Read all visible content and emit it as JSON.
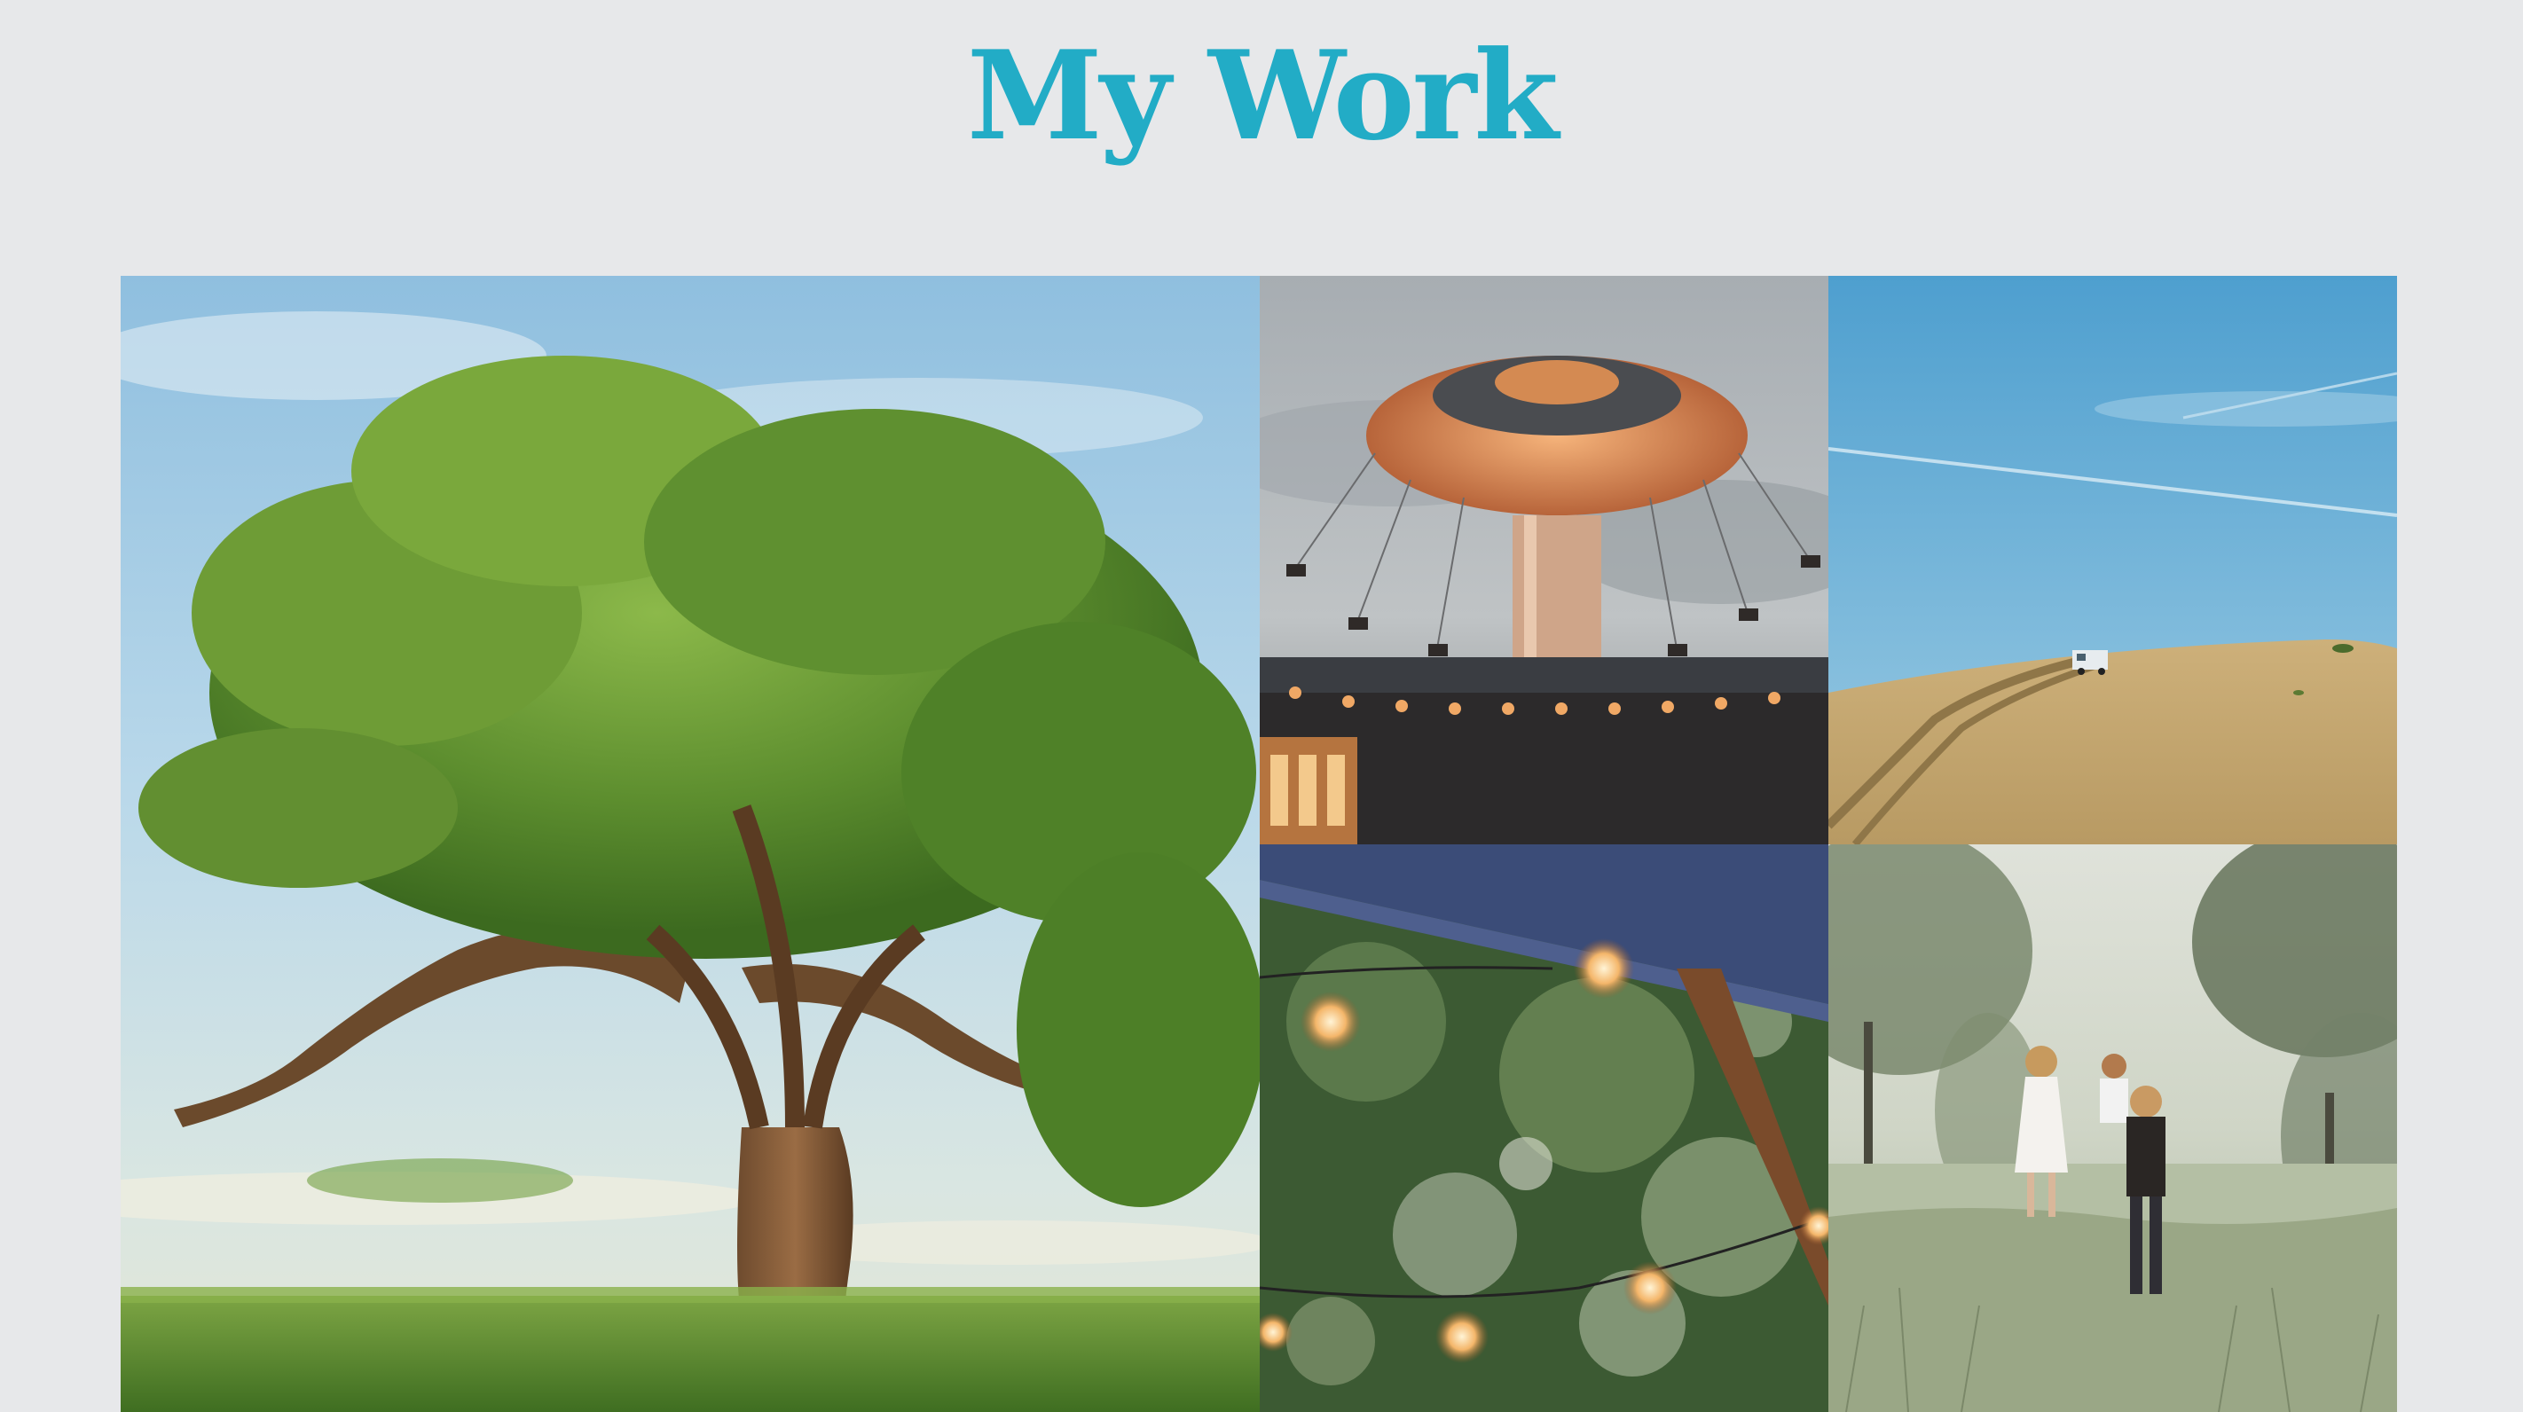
{
  "header": {
    "title": "My Work"
  },
  "gallery": {
    "items": [
      {
        "icon": "tree-photo",
        "alt": ""
      },
      {
        "icon": "swing-carousel-photo",
        "alt": ""
      },
      {
        "icon": "hill-with-van-photo",
        "alt": ""
      },
      {
        "icon": "string-lights-photo",
        "alt": ""
      },
      {
        "icon": "children-in-meadow-photo",
        "alt": ""
      }
    ]
  },
  "colors": {
    "background": "#e7e8ea",
    "title": "#22acc6"
  }
}
